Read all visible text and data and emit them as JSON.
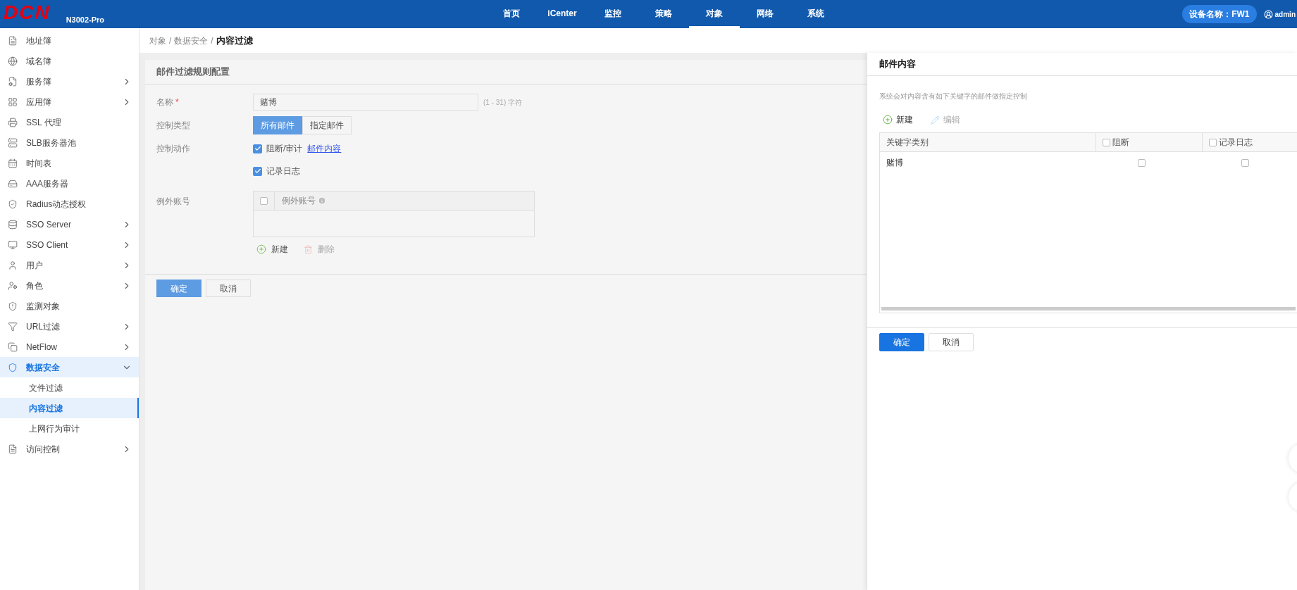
{
  "header": {
    "logo": "DCN",
    "model": "N3002-Pro",
    "nav": [
      {
        "label": "首页",
        "selected": false
      },
      {
        "label": "iCenter",
        "selected": false
      },
      {
        "label": "监控",
        "selected": false
      },
      {
        "label": "策略",
        "selected": false
      },
      {
        "label": "对象",
        "selected": true
      },
      {
        "label": "网络",
        "selected": false
      },
      {
        "label": "系统",
        "selected": false
      }
    ],
    "device": "设备名称：FW1",
    "user": "admin"
  },
  "sidebar": {
    "items": [
      {
        "label": "地址簿",
        "expandable": false,
        "selected": false
      },
      {
        "label": "域名簿",
        "expandable": false,
        "selected": false
      },
      {
        "label": "服务簿",
        "expandable": true,
        "expanded": false,
        "selected": false
      },
      {
        "label": "应用簿",
        "expandable": true,
        "expanded": false,
        "selected": false
      },
      {
        "label": "SSL 代理",
        "expandable": false,
        "selected": false
      },
      {
        "label": "SLB服务器池",
        "expandable": false,
        "selected": false
      },
      {
        "label": "时间表",
        "expandable": false,
        "selected": false
      },
      {
        "label": "AAA服务器",
        "expandable": false,
        "selected": false
      },
      {
        "label": "Radius动态授权",
        "expandable": false,
        "selected": false
      },
      {
        "label": "SSO Server",
        "expandable": true,
        "expanded": false,
        "selected": false
      },
      {
        "label": "SSO Client",
        "expandable": true,
        "expanded": false,
        "selected": false
      },
      {
        "label": "用户",
        "expandable": true,
        "expanded": false,
        "selected": false
      },
      {
        "label": "角色",
        "expandable": true,
        "expanded": false,
        "selected": false
      },
      {
        "label": "监测对象",
        "expandable": false,
        "selected": false
      },
      {
        "label": "URL过滤",
        "expandable": true,
        "expanded": false,
        "selected": false
      },
      {
        "label": "NetFlow",
        "expandable": true,
        "expanded": false,
        "selected": false
      },
      {
        "label": "数据安全",
        "expandable": true,
        "expanded": true,
        "selected": true,
        "children": [
          {
            "label": "文件过滤",
            "selected": false
          },
          {
            "label": "内容过滤",
            "selected": true
          },
          {
            "label": "上网行为审计",
            "selected": false
          }
        ]
      },
      {
        "label": "访问控制",
        "expandable": true,
        "expanded": false,
        "selected": false
      }
    ]
  },
  "breadcrumb": {
    "separator": "/",
    "items": [
      "对象",
      "数据安全",
      "内容过滤"
    ]
  },
  "form": {
    "title": "邮件过滤规则配置",
    "name": {
      "label": "名称",
      "required": true,
      "required_mark": "*",
      "value": "赌博",
      "hint": "(1 - 31) 字符"
    },
    "control_type": {
      "label": "控制类型",
      "options": [
        {
          "label": "所有邮件",
          "selected": true
        },
        {
          "label": "指定邮件",
          "selected": false
        }
      ]
    },
    "control_action": {
      "label": "控制动作",
      "options": [
        {
          "label": "阻断/审计",
          "checked": true,
          "link": "邮件内容"
        },
        {
          "label": "记录日志",
          "checked": true
        }
      ]
    },
    "exceptions": {
      "label": "例外账号",
      "column": "例外账号",
      "select_all": false,
      "actions": [
        {
          "label": "新建",
          "disabled": false
        },
        {
          "label": "删除",
          "disabled": true
        }
      ]
    },
    "buttons": [
      {
        "label": "确定",
        "primary": true
      },
      {
        "label": "取消",
        "primary": false
      }
    ]
  },
  "drawer": {
    "title": "邮件内容",
    "description": "系统会对内容含有如下关键字的邮件做指定控制",
    "toolbar": [
      {
        "label": "新建",
        "disabled": false
      },
      {
        "label": "编辑",
        "disabled": true
      }
    ],
    "columns": [
      {
        "label": "关键字类别",
        "kind": "text"
      },
      {
        "label": "阻断",
        "kind": "checkbox",
        "checked": false
      },
      {
        "label": "记录日志",
        "kind": "checkbox",
        "checked": false
      }
    ],
    "rows": [
      {
        "keyword": "赌博",
        "block": false,
        "log": false
      }
    ],
    "buttons": [
      {
        "label": "确定",
        "primary": true
      },
      {
        "label": "取消",
        "primary": false
      }
    ]
  }
}
